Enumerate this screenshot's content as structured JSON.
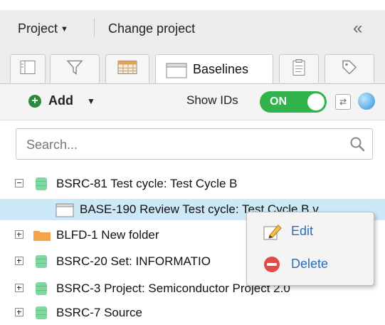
{
  "header": {
    "project_menu": "Project",
    "change_project": "Change project",
    "collapse": "«"
  },
  "tabs": [
    {
      "icon": "details-icon",
      "active": false
    },
    {
      "icon": "filter-icon",
      "active": false
    },
    {
      "icon": "grid-icon",
      "active": false
    },
    {
      "icon": "window-icon",
      "label": "Baselines",
      "active": true
    },
    {
      "icon": "clipboard-icon",
      "active": false
    },
    {
      "icon": "tag-icon",
      "active": false
    }
  ],
  "toolbar": {
    "add_label": "Add",
    "show_ids_label": "Show IDs",
    "toggle_state": "ON"
  },
  "search": {
    "placeholder": "Search..."
  },
  "tree": [
    {
      "label": "BSRC-81 Test cycle: Test Cycle B",
      "icon": "green-source-icon",
      "expander": "minus"
    },
    {
      "label": "BASE-190 Review Test cycle: Test Cycle B v",
      "icon": "baseline-icon",
      "selected": true
    },
    {
      "label": "BLFD-1 New folder",
      "icon": "folder-icon",
      "expander": "plus"
    },
    {
      "label": "BSRC-20 Set: INFORMATIO",
      "icon": "green-source-icon",
      "expander": "plus"
    },
    {
      "label": "BSRC-3 Project: Semiconductor Project 2.0",
      "icon": "green-source-icon",
      "expander": "plus"
    },
    {
      "label": "BSRC-7 Source",
      "icon": "green-source-icon",
      "expander": "plus"
    }
  ],
  "context_menu": {
    "edit": "Edit",
    "delete": "Delete"
  },
  "colors": {
    "toggle_on": "#2fb34a",
    "selection": "#cde8f7",
    "menu_text": "#2a6ebb",
    "source_green": "#7fd8a0",
    "folder_orange": "#f5a24b"
  }
}
